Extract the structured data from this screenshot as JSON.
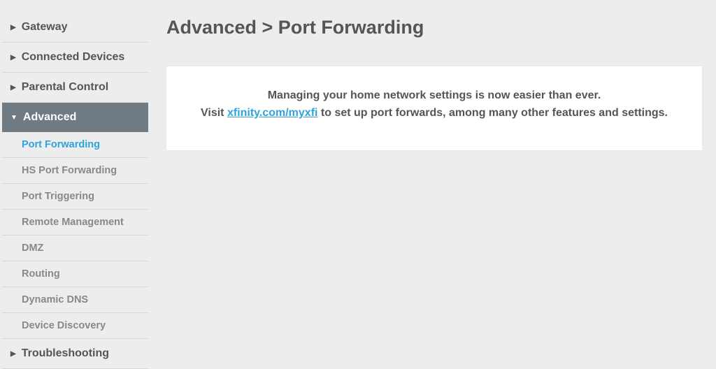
{
  "sidebar": {
    "items": [
      {
        "label": "Gateway",
        "expanded": false,
        "active": false
      },
      {
        "label": "Connected Devices",
        "expanded": false,
        "active": false
      },
      {
        "label": "Parental Control",
        "expanded": false,
        "active": false
      },
      {
        "label": "Advanced",
        "expanded": true,
        "active": true,
        "children": [
          {
            "label": "Port Forwarding",
            "current": true
          },
          {
            "label": "HS Port Forwarding",
            "current": false
          },
          {
            "label": "Port Triggering",
            "current": false
          },
          {
            "label": "Remote Management",
            "current": false
          },
          {
            "label": "DMZ",
            "current": false
          },
          {
            "label": "Routing",
            "current": false
          },
          {
            "label": "Dynamic DNS",
            "current": false
          },
          {
            "label": "Device Discovery",
            "current": false
          }
        ]
      },
      {
        "label": "Troubleshooting",
        "expanded": false,
        "active": false
      }
    ]
  },
  "main": {
    "title": "Advanced > Port Forwarding",
    "message_line1": "Managing your home network settings is now easier than ever.",
    "message_visit": "Visit ",
    "link_text": "xfinity.com/myxfi",
    "message_after": " to set up port forwards, among many other features and settings."
  }
}
